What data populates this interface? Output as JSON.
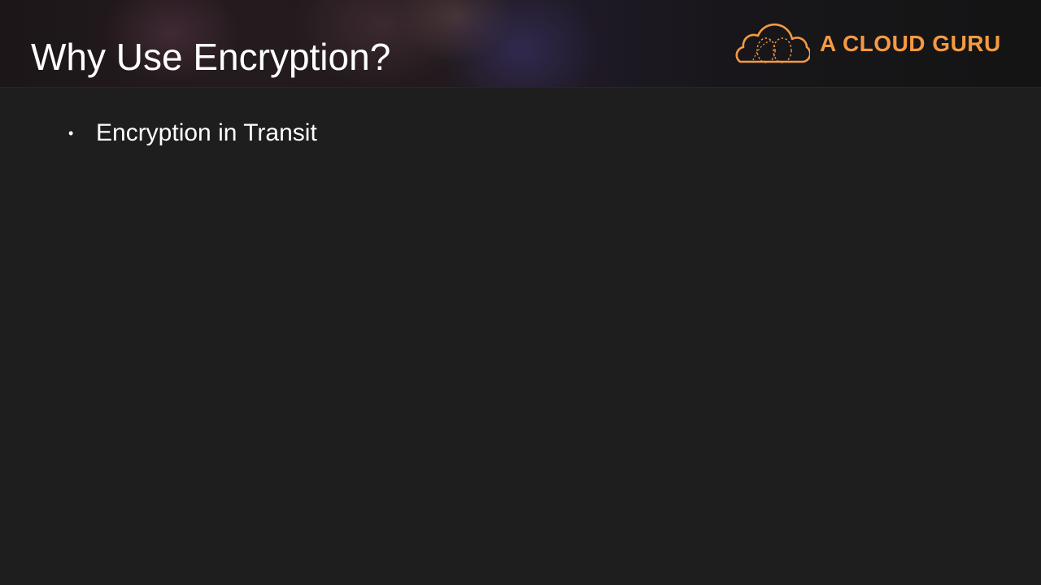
{
  "slide": {
    "title": "Why Use Encryption?",
    "bullets": [
      {
        "text": "Encryption in Transit"
      }
    ]
  },
  "logo": {
    "text": "A CLOUD GURU",
    "icon": "cloud-icon",
    "color": "#f59a42"
  },
  "colors": {
    "background": "#1e1e1e",
    "text": "#ffffff",
    "accent": "#f59a42"
  }
}
